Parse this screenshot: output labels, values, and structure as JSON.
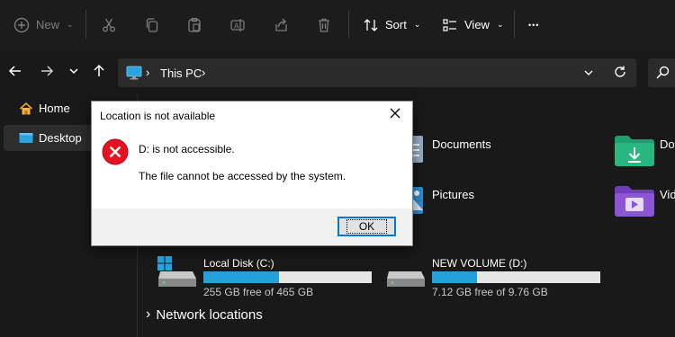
{
  "toolbar": {
    "new_label": "New",
    "sort_label": "Sort",
    "view_label": "View",
    "more_glyph": "•••"
  },
  "address": {
    "location": "This PC",
    "separator": "›"
  },
  "sidebar": {
    "items": [
      {
        "label": "Home",
        "icon": "home-icon",
        "selected": false
      },
      {
        "label": "Desktop",
        "icon": "desktop-folder-icon",
        "selected": true
      }
    ]
  },
  "folders": [
    {
      "label": "Documents",
      "icon": "documents-folder-icon"
    },
    {
      "label": "Pictures",
      "icon": "pictures-folder-icon"
    },
    {
      "label": "Dov",
      "icon": "downloads-folder-icon"
    },
    {
      "label": "Vid",
      "icon": "videos-folder-icon"
    }
  ],
  "drives": [
    {
      "name": "Local Disk (C:)",
      "free_text": "255 GB free of 465 GB",
      "used_fraction": 0.45
    },
    {
      "name": "NEW VOLUME (D:)",
      "free_text": "7.12 GB free of 9.76 GB",
      "used_fraction": 0.27
    }
  ],
  "network": {
    "label": "Network locations",
    "chevron": "›"
  },
  "dialog": {
    "title": "Location is not available",
    "message1": "D: is not accessible.",
    "message2": "The file cannot be accessed by the system.",
    "ok_label": "OK"
  },
  "colors": {
    "accent": "#26a0da",
    "error_red": "#e81123",
    "dark_bg": "#191919"
  }
}
